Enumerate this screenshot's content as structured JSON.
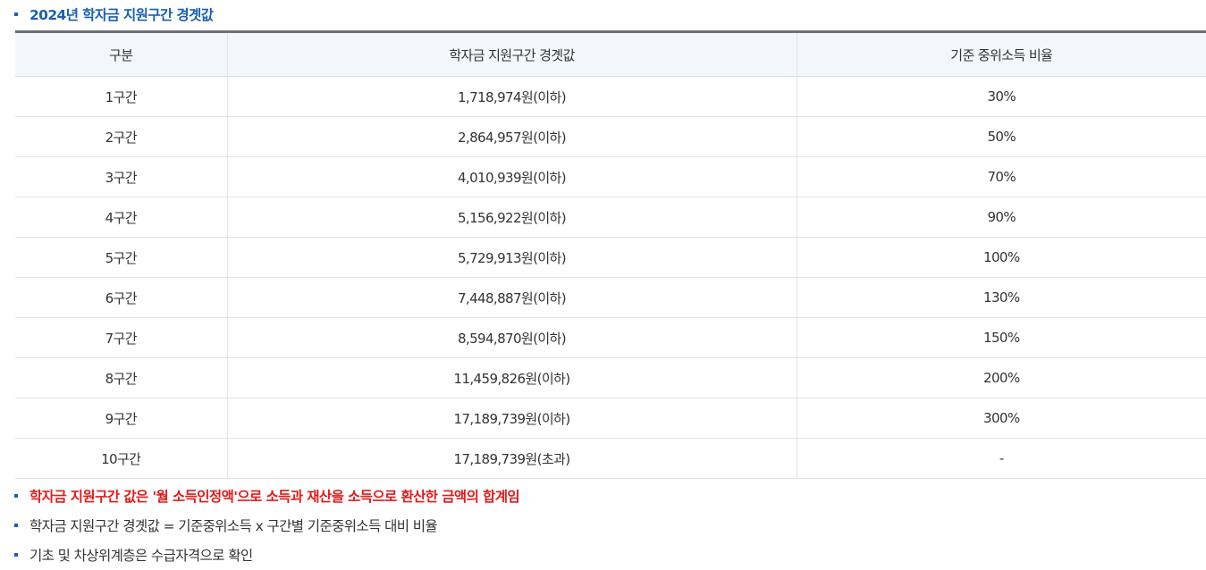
{
  "heading": "2024년 학자금 지원구간 경곗값",
  "table": {
    "headers": [
      "구분",
      "학자금 지원구간 경곗값",
      "기준 중위소득 비율"
    ],
    "rows": [
      [
        "1구간",
        "1,718,974원(이하)",
        "30%"
      ],
      [
        "2구간",
        "2,864,957원(이하)",
        "50%"
      ],
      [
        "3구간",
        "4,010,939원(이하)",
        "70%"
      ],
      [
        "4구간",
        "5,156,922원(이하)",
        "90%"
      ],
      [
        "5구간",
        "5,729,913원(이하)",
        "100%"
      ],
      [
        "6구간",
        "7,448,887원(이하)",
        "130%"
      ],
      [
        "7구간",
        "8,594,870원(이하)",
        "150%"
      ],
      [
        "8구간",
        "11,459,826원(이하)",
        "200%"
      ],
      [
        "9구간",
        "17,189,739원(이하)",
        "300%"
      ],
      [
        "10구간",
        "17,189,739원(초과)",
        "-"
      ]
    ]
  },
  "notes": [
    "학자금 지원구간 값은 '월 소득인정액'으로 소득과 재산을 소득으로 환산한 금액의 합계임",
    "학자금 지원구간 경곗값 = 기준중위소득 x 구간별 기준중위소득 대비 비율",
    "기초 및 차상위계층은 수급자격으로 확인"
  ],
  "colors": {
    "heading": "#1a5fb4",
    "highlight_note": "#e11b1b",
    "bullet": "#1a5fb4",
    "table_header_bg": "#f3f6fb",
    "table_top_border": "#6b6f78"
  }
}
